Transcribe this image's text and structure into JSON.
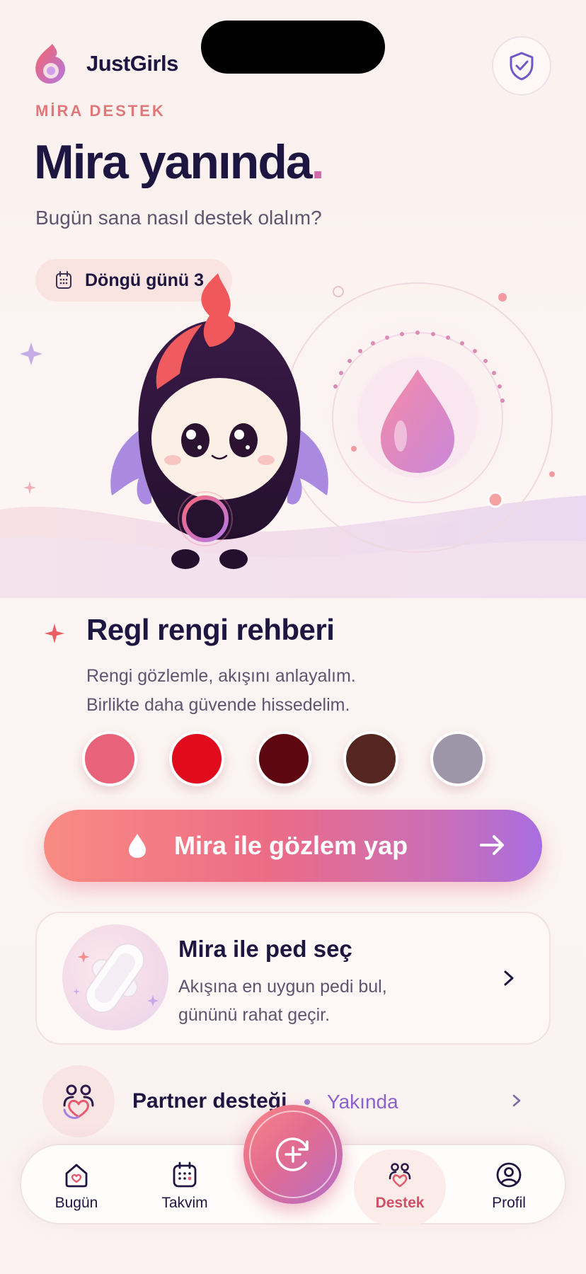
{
  "app": {
    "name": "JustGirls"
  },
  "header": {
    "eyebrow": "MİRA DESTEK",
    "title": "Mira yanında",
    "title_dot": ".",
    "subtitle": "Bugün sana nasıl destek olalım?",
    "cycle_chip": "Döngü günü 3"
  },
  "guide": {
    "title": "Regl rengi rehberi",
    "line1": "Rengi gözlemle, akışını anlayalım.",
    "line2": "Birlikte daha güvende hissedelim.",
    "swatches": [
      "#e8637a",
      "#e00b1c",
      "#5e0712",
      "#552621",
      "#9d96a8"
    ]
  },
  "cta": {
    "label": "Mira ile gözlem yap"
  },
  "pad_card": {
    "title": "Mira ile ped seç",
    "desc1": "Akışına en uygun pedi bul,",
    "desc2": "gününü rahat geçir."
  },
  "partner": {
    "label": "Partner desteği",
    "badge": "Yakında"
  },
  "tabs": [
    {
      "label": "Bugün",
      "icon": "home-icon"
    },
    {
      "label": "Takvim",
      "icon": "calendar-icon"
    },
    {
      "label": "Destek",
      "icon": "support-icon",
      "active": true
    },
    {
      "label": "Profil",
      "icon": "profile-icon"
    }
  ],
  "colors": {
    "primary_text": "#1d1640",
    "accent_coral": "#e0787a",
    "accent_purple": "#8b62cc",
    "active_tab": "#d05066"
  }
}
